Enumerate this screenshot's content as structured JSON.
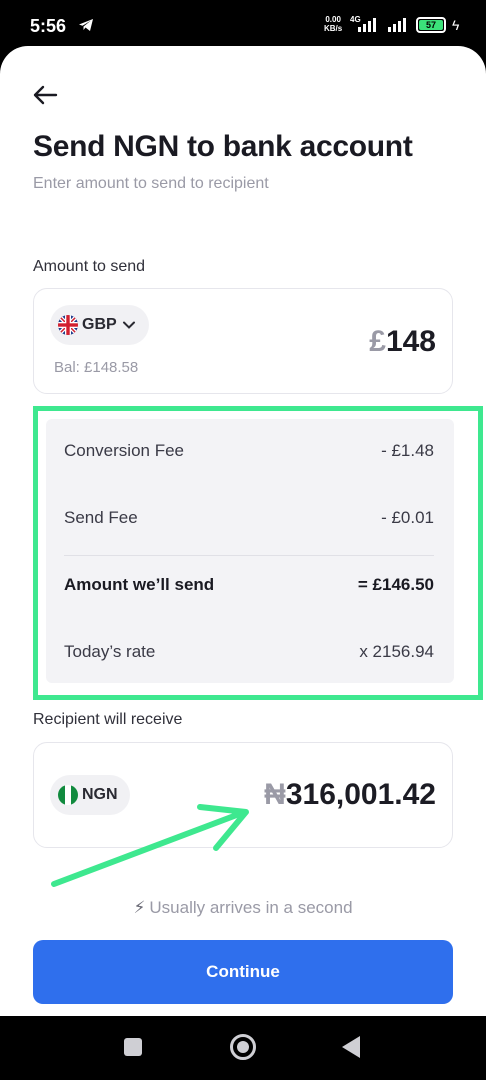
{
  "status_bar": {
    "time": "5:56",
    "net_speed_value": "0.00",
    "net_speed_unit": "KB/s",
    "network_type": "4G",
    "battery": "57"
  },
  "header": {
    "title": "Send NGN to bank account",
    "subtitle": "Enter amount to send to recipient"
  },
  "send": {
    "label": "Amount to send",
    "currency": "GBP",
    "balance": "Bal: £148.58",
    "amount_symbol": "£",
    "amount_value": "148"
  },
  "fees": {
    "rows": [
      {
        "label": "Conversion Fee",
        "value": "- £1.48"
      },
      {
        "label": "Send Fee",
        "value": "- £0.01"
      },
      {
        "label": "Amount we’ll send",
        "value": "= £146.50"
      },
      {
        "label": "Today’s rate",
        "value": "x 2156.94"
      }
    ]
  },
  "receive": {
    "label": "Recipient will receive",
    "currency": "NGN",
    "amount_symbol": "₦",
    "amount_value": "316,001.42"
  },
  "eta": "Usually arrives in a second",
  "continue_label": "Continue",
  "colors": {
    "accent": "#2f6fed",
    "annotation": "#3ee88f"
  }
}
